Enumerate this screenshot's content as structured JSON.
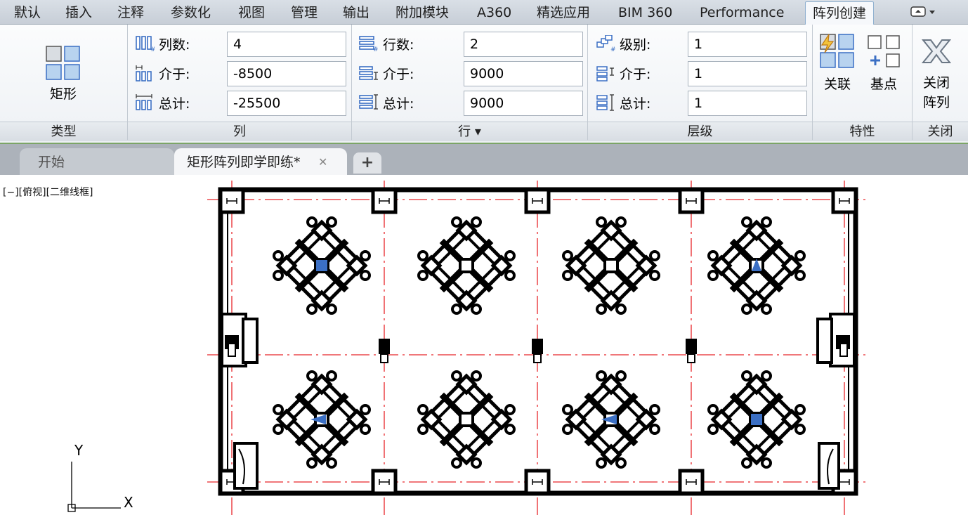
{
  "ribbon": {
    "tabs": [
      "默认",
      "插入",
      "注释",
      "参数化",
      "视图",
      "管理",
      "输出",
      "附加模块",
      "A360",
      "精选应用",
      "BIM 360",
      "Performance",
      "阵列创建"
    ],
    "active_tab": "阵列创建",
    "extra": "▭ ▾"
  },
  "panel": {
    "type": {
      "button_label": "矩形",
      "group": "类型"
    },
    "columns": {
      "group": "列",
      "count_label": "列数:",
      "count_value": "4",
      "between_label": "介于:",
      "between_value": "-8500",
      "total_label": "总计:",
      "total_value": "-25500"
    },
    "rows": {
      "group": "行 ▾",
      "count_label": "行数:",
      "count_value": "2",
      "between_label": "介于:",
      "between_value": "9000",
      "total_label": "总计:",
      "total_value": "9000"
    },
    "levels": {
      "group": "层级",
      "count_label": "级别:",
      "count_value": "1",
      "between_label": "介于:",
      "between_value": "1",
      "total_label": "总计:",
      "total_value": "1"
    },
    "properties": {
      "group": "特性",
      "associative_label": "关联",
      "basepoint_label": "基点"
    },
    "close": {
      "group": "关闭",
      "button_label_1": "关闭",
      "button_label_2": "阵列"
    }
  },
  "document_tabs": {
    "start": "开始",
    "active": "矩形阵列即学即练*",
    "close": "✕",
    "new": "+"
  },
  "canvas": {
    "viewport_label": "[−][俯视][二维线框]",
    "ucs_y": "Y",
    "ucs_x": "X"
  },
  "colors": {
    "grid_red": "#e8262b",
    "accent_blue": "#3b6fc4",
    "ribbon_green": "#7ca567"
  }
}
